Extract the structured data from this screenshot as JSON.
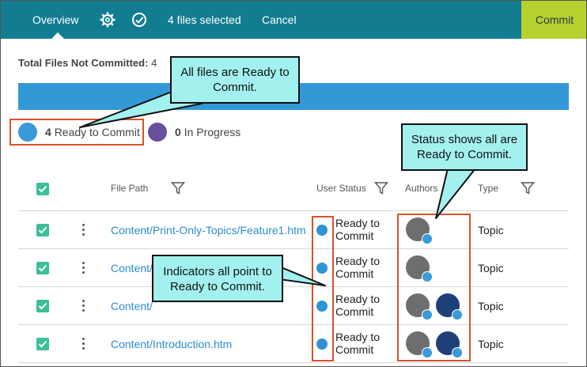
{
  "topbar": {
    "overview_label": "Overview",
    "selected_text": "4 files selected",
    "cancel_label": "Cancel",
    "commit_label": "Commit",
    "icons": [
      "gear-icon",
      "check-circle-icon"
    ]
  },
  "summary": {
    "total_label": "Total Files Not Committed:",
    "total_value": "4"
  },
  "legend": {
    "ready_count": "4",
    "ready_label": "Ready to Commit",
    "progress_count": "0",
    "progress_label": "In Progress"
  },
  "table": {
    "columns": {
      "file_path": "File Path",
      "user_status": "User Status",
      "authors": "Authors",
      "type": "Type"
    },
    "rows": [
      {
        "path": "Content/Print-Only-Topics/Feature1.htm",
        "status": "Ready to Commit",
        "type": "Topic",
        "authors": 1
      },
      {
        "path": "Content/",
        "status": "Ready to Commit",
        "type": "Topic",
        "authors": 1
      },
      {
        "path": "Content/",
        "status": "Ready to Commit",
        "type": "Topic",
        "authors": 2
      },
      {
        "path": "Content/Introduction.htm",
        "status": "Ready to Commit",
        "type": "Topic",
        "authors": 2
      }
    ]
  },
  "callouts": {
    "legend_callout": "All files are Ready to Commit.",
    "status_callout": "Status shows all are Ready to Commit.",
    "indicator_callout": "Indicators all point to Ready to Commit."
  },
  "colors": {
    "topbar": "#127d91",
    "commit_button": "#b7d131",
    "ready": "#3a9ad9",
    "in_progress": "#6a4f9d",
    "callout_fill": "#a2f1ef",
    "annotation_box": "#d9532c"
  }
}
